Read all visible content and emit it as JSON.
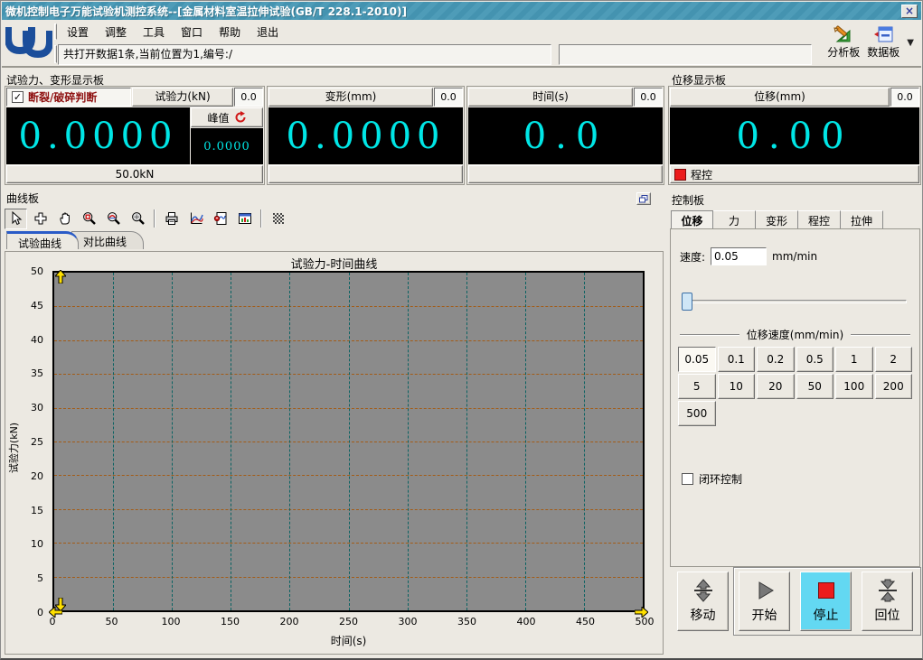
{
  "window": {
    "title": "微机控制电子万能试验机测控系统--[金属材料室温拉伸试验(GB/T 228.1-2010)]",
    "close_glyph": "×"
  },
  "menu": {
    "items": [
      "设置",
      "调整",
      "工具",
      "窗口",
      "帮助",
      "退出"
    ]
  },
  "toolbar": {
    "status_text": "共打开数据1条,当前位置为1,编号:/",
    "analysis_label": "分析板",
    "data_label": "数据板",
    "icons": [
      "analysis-board-icon",
      "data-board-icon",
      "dropdown-arrow-icon"
    ]
  },
  "force_panel": {
    "title": "试验力、变形显示板",
    "break_check_label": "断裂/破碎判断",
    "break_checked": true,
    "check_glyph": "✓",
    "force": {
      "header": "试验力(kN)",
      "aux": "0.0",
      "value": "0.0000",
      "peak_label": "峰值",
      "peak_value": "0.0000",
      "range": "50.0kN"
    },
    "deform": {
      "header": "变形(mm)",
      "aux": "0.0",
      "value": "0.0000",
      "footer": ""
    },
    "time": {
      "header": "时间(s)",
      "aux": "0.0",
      "value": "0.0",
      "footer": ""
    }
  },
  "displacement_panel": {
    "title": "位移显示板",
    "header": "位移(mm)",
    "aux": "0.0",
    "value": "0.00",
    "status_label": "程控"
  },
  "curve_panel": {
    "title": "曲线板",
    "tools": [
      "cursor",
      "crosshair",
      "pan",
      "zoom-area",
      "zoom-curve",
      "zoom-out",
      "print",
      "curve-options",
      "report",
      "data-window",
      "texture"
    ],
    "tabs": [
      "试验曲线",
      "对比曲线"
    ],
    "active_tab": 0
  },
  "chart_data": {
    "type": "line",
    "title": "试验力-时间曲线",
    "xlabel": "时间(s)",
    "ylabel": "试验力(kN)",
    "xlim": [
      0,
      500
    ],
    "ylim": [
      0,
      50
    ],
    "xticks": [
      0,
      50,
      100,
      150,
      200,
      250,
      300,
      350,
      400,
      450,
      500
    ],
    "yticks": [
      0,
      5,
      10,
      15,
      20,
      25,
      30,
      35,
      40,
      45,
      50
    ],
    "grid": {
      "show": true,
      "h_color": "#A35C17",
      "v_color": "#0B6363",
      "style": "dashed"
    },
    "plot_bg": "#8B8B8B",
    "legend": "none",
    "series": [
      {
        "name": "试验力",
        "x": [],
        "y": []
      }
    ]
  },
  "control_panel": {
    "title": "控制板",
    "tabs": [
      "位移",
      "力",
      "变形",
      "程控",
      "拉伸"
    ],
    "active_tab": 0,
    "speed": {
      "label": "速度:",
      "value": "0.05",
      "unit": "mm/min"
    },
    "speed_group": {
      "title": "位移速度(mm/min)",
      "options": [
        "0.05",
        "0.1",
        "0.2",
        "0.5",
        "1",
        "2",
        "5",
        "10",
        "20",
        "50",
        "100",
        "200",
        "500"
      ],
      "selected": "0.05"
    },
    "closed_loop": {
      "label": "闭环控制",
      "checked": false
    },
    "actions": {
      "move": "移动",
      "start": "开始",
      "stop": "停止",
      "home": "回位"
    }
  },
  "colors": {
    "titlebar": "#4493B0",
    "lcd_text": "#00E6E6",
    "alert_text": "#8E1010",
    "stop_bg": "#63D8F2",
    "stop_square": "#EC1C1C",
    "program_square": "#EC1C1C",
    "accent_blue": "#2A5BC7"
  }
}
